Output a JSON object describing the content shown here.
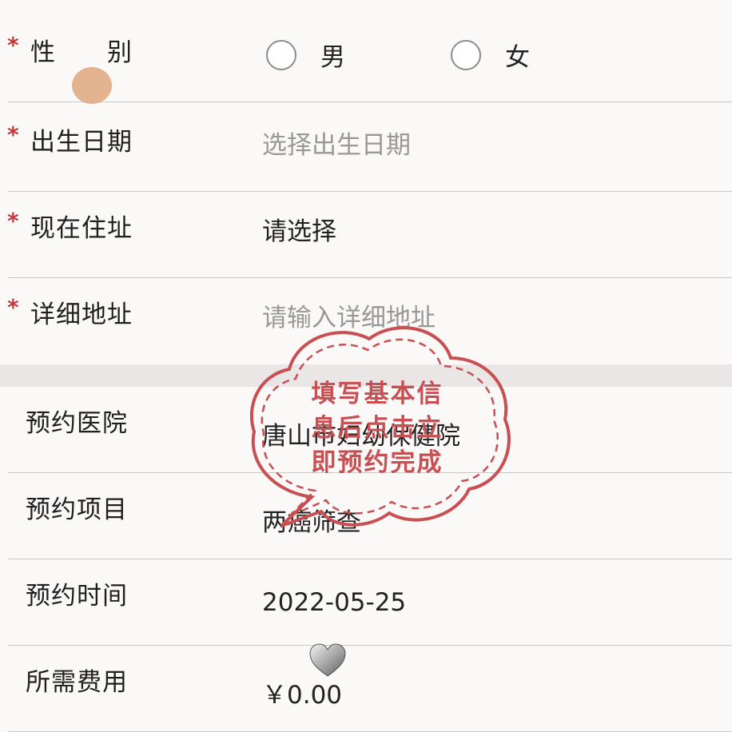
{
  "form": {
    "gender": {
      "label": "性　　别",
      "required_mark": "*",
      "options": [
        "男",
        "女"
      ]
    },
    "birth_date": {
      "label": "出生日期",
      "required_mark": "*",
      "placeholder": "选择出生日期"
    },
    "current_address": {
      "label": "现在住址",
      "required_mark": "*",
      "value": "请选择"
    },
    "detail_address": {
      "label": "详细地址",
      "required_mark": "*",
      "placeholder": "请输入详细地址"
    },
    "hospital": {
      "label": "预约医院",
      "value": "唐山市妇幼保健院"
    },
    "project": {
      "label": "预约项目",
      "value": "两癌筛查"
    },
    "time": {
      "label": "预约时间",
      "value": "2022-05-25"
    },
    "fee": {
      "label": "所需费用",
      "value": "￥0.00"
    }
  },
  "stamp": {
    "text": "填写基本信\n息后点击立\n即预约完成",
    "color": "#c84f52"
  },
  "colors": {
    "required": "#c43a3a",
    "placeholder": "#9a9797",
    "separator": "#c9c6c6"
  }
}
